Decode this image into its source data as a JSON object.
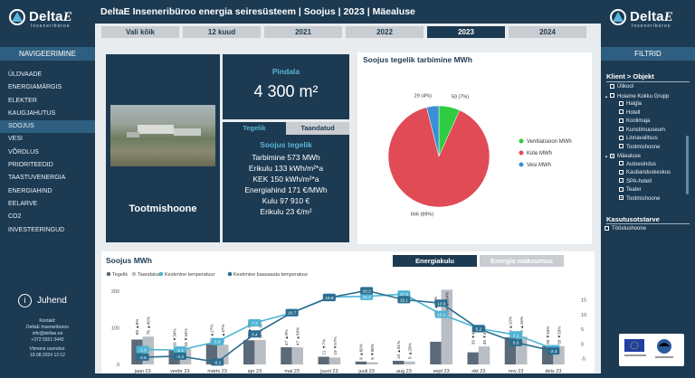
{
  "app": {
    "brand": "Delta",
    "brand_e": "E",
    "brand_sub": "Inseneribüroo",
    "header_title": "DeltaE Inseneribüroo energia seiresüsteem | Soojus | 2023 | Mäealuse"
  },
  "nav": {
    "title": "NAVIGEERIMINE",
    "items": [
      "ÜLDVAADE",
      "ENERGIAMÄRGIS",
      "ELEKTER",
      "KAUGJAHUTUS",
      "SOOJUS",
      "VESI",
      "VÕRDLUS",
      "PRIORITEEDID",
      "TAASTUVENERGIA",
      "ENERGIAHIND",
      "EELARVE",
      "CO2",
      "INVESTEERINGUD"
    ],
    "active_index": 4
  },
  "help": {
    "label": "Juhend",
    "icon": "info-icon"
  },
  "contact": {
    "line1": "Kontakt:",
    "line2": "DeltaE Inseneribüroo",
    "line3": "info@deltae.ee",
    "line4": "+372 5551 0442",
    "updated_label": "Viimane uuendus:",
    "updated_value": "19.08.2024 12:12"
  },
  "period_tabs": {
    "items": [
      "Vali kõik",
      "12 kuud",
      "2021",
      "2022",
      "2023",
      "2024"
    ],
    "selected_index": 4
  },
  "building": {
    "name": "Tootmishoone"
  },
  "area": {
    "label": "Pindala",
    "value": "4 300 m²"
  },
  "stats": {
    "tab_actual": "Tegelik",
    "tab_normalized": "Taandatud",
    "title": "Soojus tegelik",
    "lines": [
      "Tarbimine 573 MWh",
      "Erikulu 133 kWh/m²*a",
      "KEK 150 kWh/m²*a",
      "Energiahind 171 €/MWh",
      "Kulu 97 910 €",
      "Erikulu 23 €/m²"
    ]
  },
  "pie": {
    "title": "Soojus tegelik tarbimine MWh"
  },
  "bar": {
    "title": "Soojus MWh",
    "tab_energy": "Energiakulu",
    "tab_cost": "Energia maksumus",
    "legend": [
      "Tegelik",
      "Taandatud",
      "Keskmine temperatuur",
      "Keskmine baasaasta temperatuur"
    ],
    "icon": "arrow-icon"
  },
  "filters": {
    "title": "FILTRID",
    "section1": "Klient > Objekt",
    "section2": "Kasutusotstarve",
    "tree": [
      {
        "label": "Ülikool",
        "level": 0,
        "exp": "",
        "checked": false
      },
      {
        "label": "Hoiame Kokku Grupp",
        "level": 0,
        "exp": "▲",
        "checked": false
      },
      {
        "label": "Haigla",
        "level": 1,
        "exp": "",
        "checked": false
      },
      {
        "label": "Hotell",
        "level": 1,
        "exp": "",
        "checked": false
      },
      {
        "label": "Koolimaja",
        "level": 1,
        "exp": "",
        "checked": false
      },
      {
        "label": "Kunstimuuseum",
        "level": 1,
        "exp": "",
        "checked": false
      },
      {
        "label": "Linnavalitsus",
        "level": 1,
        "exp": "",
        "checked": false
      },
      {
        "label": "Tootmishoone",
        "level": 1,
        "exp": "",
        "checked": false
      },
      {
        "label": "Mäealuse",
        "level": 0,
        "exp": "▲",
        "checked": true
      },
      {
        "label": "Autoesindus",
        "level": 1,
        "exp": "",
        "checked": false
      },
      {
        "label": "Kaubanduskeskus",
        "level": 1,
        "exp": "",
        "checked": false
      },
      {
        "label": "SPA-hotell",
        "level": 1,
        "exp": "",
        "checked": false
      },
      {
        "label": "Teater",
        "level": 1,
        "exp": "",
        "checked": false
      },
      {
        "label": "Tootmishoone",
        "level": 1,
        "exp": "",
        "checked": true
      }
    ],
    "usage": [
      "Tööstushoone"
    ]
  },
  "colors": {
    "navy": "#1c3a52",
    "accent": "#5ab5d8",
    "green": "#2ecc40",
    "red": "#e04b55",
    "blue": "#3a8fd6",
    "bar_actual": "#5b6a78",
    "bar_norm": "#b8bec4",
    "temp": "#4fb3d4",
    "temp_base": "#2a6d8f"
  },
  "chart_data": [
    {
      "type": "pie",
      "title": "Soojus tegelik tarbimine MWh",
      "labels": [
        "Ventilatsioon MWh",
        "Küte MWh",
        "Vesi MWh"
      ],
      "values": [
        50,
        666,
        29
      ],
      "percent": [
        7,
        89,
        4
      ],
      "slice_labels": [
        "50 (7%)",
        "666 (89%)",
        "29 (4%)"
      ]
    },
    {
      "type": "bar",
      "categories": [
        "jaan 23",
        "veebr 23",
        "märts 23",
        "apr 23",
        "mai 23",
        "juuni 23",
        "juuli 23",
        "aug 23",
        "sept 23",
        "okt 23",
        "nov 23",
        "dets 23"
      ],
      "y_left_ticks": [
        "200",
        "100",
        "0"
      ],
      "ylim_left": [
        0,
        200
      ],
      "y_right_ticks": [
        "15",
        "10",
        "5",
        "0",
        "-5"
      ],
      "ylim_right": [
        -7,
        18
      ],
      "series": [
        {
          "name": "Tegelik",
          "type": "bar",
          "values": [
            68,
            39,
            55,
            66,
            47,
            21,
            8,
            10,
            62,
            33,
            74,
            50
          ]
        },
        {
          "name": "Taandatud",
          "type": "bar",
          "values": [
            76,
            43,
            54,
            67,
            47,
            19,
            6,
            8,
            204,
            49,
            76,
            50
          ]
        },
        {
          "name": "Keskmine temperatuur",
          "type": "line",
          "values": [
            -1.9,
            -2.1,
            0.8,
            7.2,
            10.6,
            16.0,
            16.2,
            17.0,
            10.1,
            5.3,
            3.1,
            -1.6
          ]
        },
        {
          "name": "Keskmine baasaasta temperatuur",
          "type": "line",
          "values": [
            -4.5,
            -4.2,
            -6.2,
            3.4,
            10.7,
            15.8,
            18.2,
            15.1,
            13.9,
            5.2,
            0.5,
            -2.4
          ]
        }
      ],
      "bar_labels": [
        "68 ▲8%",
        "39 ▼34%",
        "55 ▲27%",
        "66 ▲15%",
        "47 ▲9%",
        "21 ▼7%",
        "8 ▲60%",
        "10 ▲81%",
        "62 ▲64%",
        "33 ▼49%",
        "74 ▲10%",
        "50 ▼33%"
      ],
      "bar_labels_norm": [
        "76 ▲45%",
        "43 ▼34%",
        "54 ▲47%",
        "67 ▲30%",
        "47 ▲59%",
        "19 ▼57%",
        "6 ▼98%",
        "8 ▲26%",
        "204 ▲264%",
        "49 ▼49%",
        "76 ▲16%",
        "50 ▼33%"
      ],
      "temp_labels": [
        "-1.9",
        "-2.1",
        "0.8",
        "7.2",
        "10.6",
        "16.0",
        "16.2",
        "17.0",
        "10.1",
        "5.3",
        "3.1",
        "-1.6"
      ],
      "base_labels": [
        "-4.5",
        "-4.2",
        "-6.2",
        "3.4",
        "10.7",
        "15.8",
        "18.2",
        "15.1",
        "13.9",
        "5.2",
        "0.5",
        "-2.4"
      ]
    }
  ]
}
